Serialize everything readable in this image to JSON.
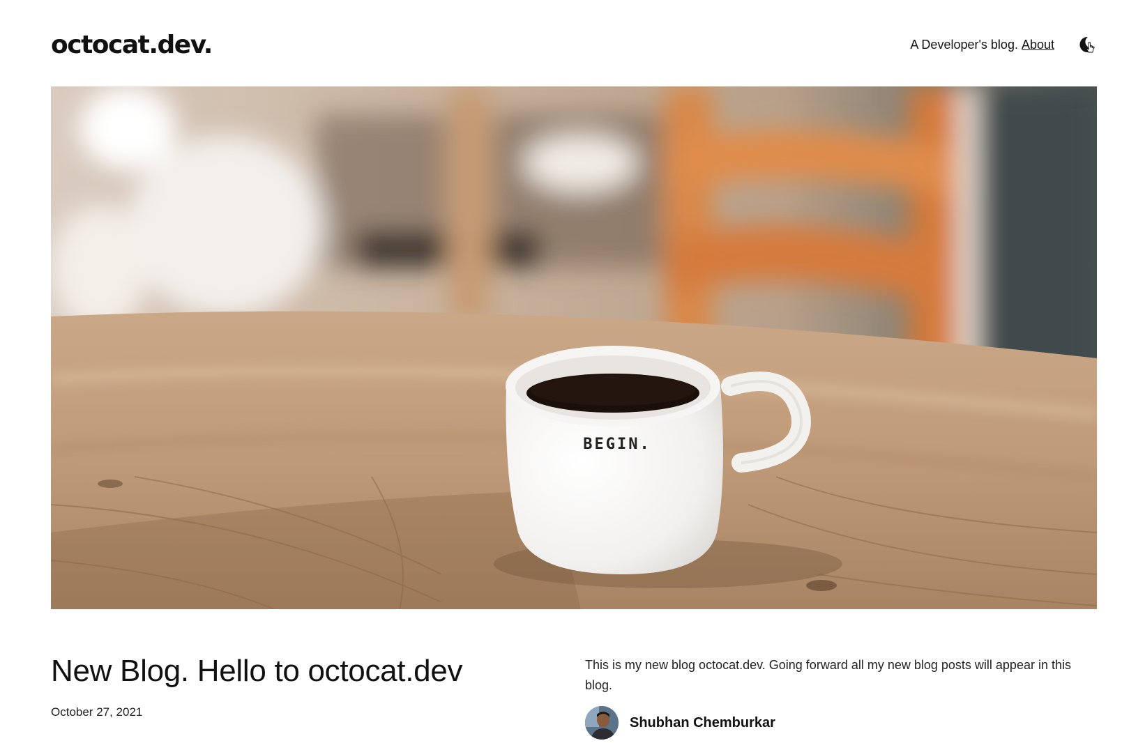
{
  "site": {
    "logo": "octocat.dev.",
    "tagline": "A Developer's blog.",
    "about_link": "About",
    "theme_icon": "moon-icon"
  },
  "hero": {
    "mug_text": "BEGIN."
  },
  "post": {
    "title": "New Blog. Hello to octocat.dev",
    "date": "October 27, 2021",
    "excerpt": "This is my new blog octocat.dev. Going forward all my new blog posts will appear in this blog.",
    "author": "Shubhan Chemburkar"
  }
}
